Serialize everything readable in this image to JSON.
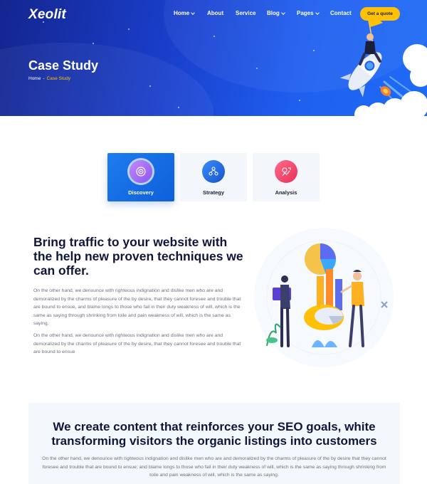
{
  "brand": {
    "logo_text": "Xeolit"
  },
  "nav": {
    "items": [
      {
        "label": "Home",
        "has_dropdown": true
      },
      {
        "label": "About",
        "has_dropdown": false
      },
      {
        "label": "Service",
        "has_dropdown": false
      },
      {
        "label": "Blog",
        "has_dropdown": true
      },
      {
        "label": "Pages",
        "has_dropdown": true
      },
      {
        "label": "Contact",
        "has_dropdown": false
      }
    ],
    "cta_label": "Get a quote"
  },
  "hero": {
    "title": "Case Study",
    "breadcrumb": {
      "home": "Home",
      "separator": "-",
      "current": "Case Study"
    }
  },
  "tabs": [
    {
      "label": "Discovery",
      "icon": "target-icon",
      "active": true,
      "icon_color": "#a46cf5"
    },
    {
      "label": "Strategy",
      "icon": "team-icon",
      "active": false,
      "icon_color": "#1f6fe0"
    },
    {
      "label": "Analysis",
      "icon": "chart-analysis-icon",
      "active": false,
      "icon_color": "#f0486e"
    }
  ],
  "content": {
    "heading": "Bring traffic to your website with the help new proven techniques we can offer.",
    "paragraph1": "On the other hand, we denounce with righteous indignation and dislike men who are and demoralized by the charms of pleasure of the by desire, that they cannot foresee and trouble that are bound to ensue, and blame longs to those who fail in their duty weakness of will, which is the same as saying through shrinking from toile and pain weakness of will, which is the same as saying.",
    "paragraph2": "On the other hand, we denounce with righteous indignation and dislike men who are and demoralized by the charms of pleasure of the by desire, that they cannot foresee and trouble that are bound to ensue"
  },
  "bottom": {
    "heading": "We create content that reinforces your SEO goals, white transforming visitors the organic listings into customers",
    "paragraph": "On the other hand, we denounce with righteous indignation and dislike men who are and demoralized by the charms of pleasure of the by desire that they cannot foresee and trouble that are bound to ensue; and blame longs to those who fail in their duty weakness of will, which is the same as saying through shrinking from toile and pain weakness of will, which is the same as saying."
  },
  "colors": {
    "accent_yellow": "#ffc107",
    "primary_blue": "#1e6cf5",
    "hero_dark": "#14258f",
    "heading_dark": "#10153a"
  }
}
